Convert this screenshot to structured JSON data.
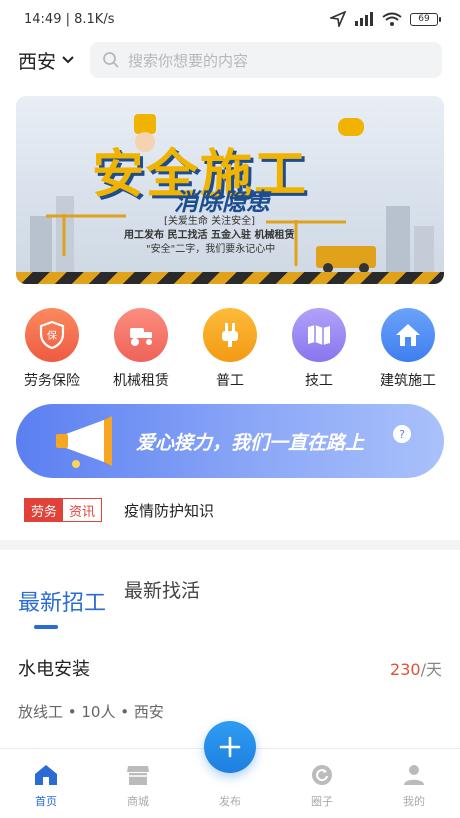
{
  "status_bar": {
    "time": "14:49",
    "speed": "8.1K/s",
    "battery": "69"
  },
  "header": {
    "city": "西安",
    "search_placeholder": "搜索你想要的内容"
  },
  "banner": {
    "title": "安全施工",
    "subtitle": "消除隐患",
    "line1": "[关爱生命 关注安全]",
    "line2": "用工发布 民工找活 五金入驻 机械租赁",
    "line3": "\"安全\"二字，我们要永记心中"
  },
  "categories": [
    {
      "label": "劳务保险",
      "icon": "shield-icon",
      "color": "#f26b4f"
    },
    {
      "label": "机械租赁",
      "icon": "tractor-icon",
      "color": "#f07a6a"
    },
    {
      "label": "普工",
      "icon": "plug-icon",
      "color": "#f6a623"
    },
    {
      "label": "技工",
      "icon": "map-icon",
      "color": "#9a88f2"
    },
    {
      "label": "建筑施工",
      "icon": "house-icon",
      "color": "#4d8cf5"
    }
  ],
  "promo": {
    "text": "爱心接力，我们一直在路上"
  },
  "news": {
    "tag_a": "劳务",
    "tag_b": "资讯",
    "text": "疫情防护知识"
  },
  "tabs": [
    {
      "label": "最新招工",
      "active": true
    },
    {
      "label": "最新找活",
      "active": false
    }
  ],
  "job": {
    "title": "水电安装",
    "pay": "230",
    "unit": "/天",
    "meta": "放线工 • 10人 • 西安"
  },
  "nav": [
    {
      "label": "首页",
      "icon": "home-icon",
      "active": true
    },
    {
      "label": "商城",
      "icon": "shop-icon",
      "active": false
    },
    {
      "label": "发布",
      "icon": "plus-icon",
      "active": false
    },
    {
      "label": "圈子",
      "icon": "refresh-icon",
      "active": false
    },
    {
      "label": "我的",
      "icon": "user-icon",
      "active": false
    }
  ]
}
